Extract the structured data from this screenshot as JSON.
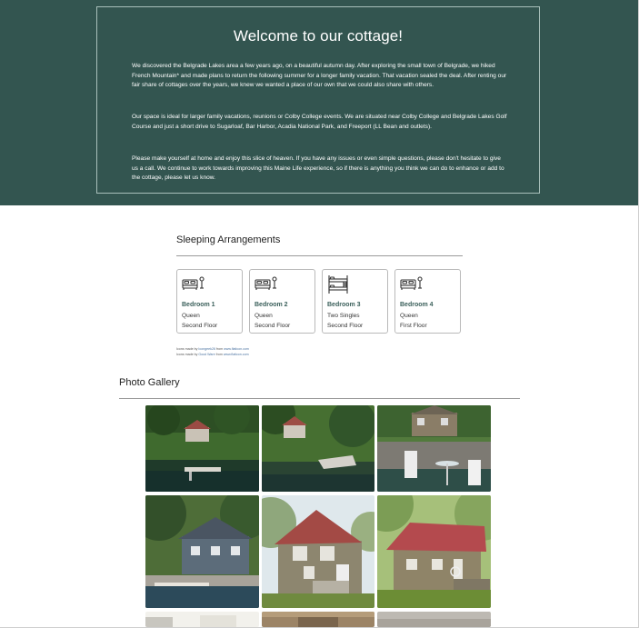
{
  "hero": {
    "title": "Welcome to our cottage!",
    "paragraph1": "We discovered the Belgrade Lakes area a few years ago, on a beautiful autumn day. After exploring the small town of Belgrade, we hiked French Mountain* and made plans to return the following summer for a longer family vacation. That vacation sealed the deal. After renting our fair share of cottages over the years, we knew we wanted a place of our own that we could also share with others.",
    "paragraph2": "Our space is ideal for larger family vacations, reunions or Colby College events. We are situated near Colby College and Belgrade Lakes Golf Course and just a short drive to Sugarloaf, Bar Harbor, Acadia National Park, and Freeport (LL Bean and outlets).",
    "paragraph3": "Please make yourself at home and enjoy this slice of heaven. If you have any issues or even simple questions, please don't hesitate to give us a call. We continue to work towards improving this Maine Life experience, so if there is anything you think we can do to enhance or add to the cottage, please let us know."
  },
  "sleeping": {
    "title": "Sleeping Arrangements",
    "rooms": [
      {
        "name": "Bedroom 1",
        "bed": "Queen",
        "floor": "Second Floor",
        "icon": "double-bed-icon"
      },
      {
        "name": "Bedroom 2",
        "bed": "Queen",
        "floor": "Second Floor",
        "icon": "double-bed-icon"
      },
      {
        "name": "Bedroom 3",
        "bed": "Two Singles",
        "floor": "Second Floor",
        "icon": "bunk-bed-icon"
      },
      {
        "name": "Bedroom 4",
        "bed": "Queen",
        "floor": "First Floor",
        "icon": "double-bed-icon"
      }
    ],
    "credits": [
      {
        "prefix": "Icons made by ",
        "author": "Icongeek26",
        "middle": " from ",
        "site": "www.flaticon.com"
      },
      {
        "prefix": "Icons made by ",
        "author": "Good Ware",
        "middle": " from ",
        "site": "www.flaticon.com"
      }
    ]
  },
  "gallery": {
    "title": "Photo Gallery"
  }
}
